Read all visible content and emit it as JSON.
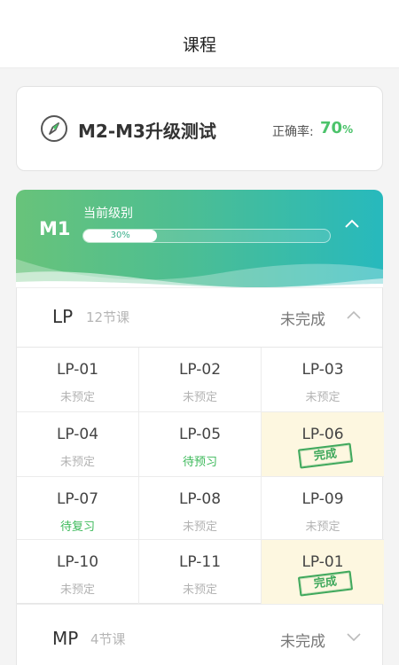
{
  "header": {
    "title": "课程"
  },
  "test": {
    "title": "M2-M3升级测试",
    "accuracy_label": "正确率:",
    "accuracy_value": "70",
    "accuracy_unit": "%"
  },
  "level": {
    "code": "M1",
    "label": "当前级别",
    "progress": 30,
    "progress_text": "30%"
  },
  "sections": [
    {
      "name": "LP",
      "count": "12节课",
      "status": "未完成",
      "expanded": true
    },
    {
      "name": "MP",
      "count": "4节课",
      "status": "未完成",
      "expanded": false
    }
  ],
  "lessons": [
    {
      "code": "LP-01",
      "status": "未预定"
    },
    {
      "code": "LP-02",
      "status": "未预定"
    },
    {
      "code": "LP-03",
      "status": "未预定"
    },
    {
      "code": "LP-04",
      "status": "未预定"
    },
    {
      "code": "LP-05",
      "status": "待预习"
    },
    {
      "code": "LP-06",
      "status": "完成"
    },
    {
      "code": "LP-07",
      "status": "待复习"
    },
    {
      "code": "LP-08",
      "status": "未预定"
    },
    {
      "code": "LP-09",
      "status": "未预定"
    },
    {
      "code": "LP-10",
      "status": "未预定"
    },
    {
      "code": "LP-11",
      "status": "未预定"
    },
    {
      "code": "LP-01",
      "status": "完成"
    }
  ],
  "colors": {
    "accent_green": "#4cc36b",
    "stamp_green": "#3fa85c",
    "done_bg": "#fdf7e0"
  }
}
